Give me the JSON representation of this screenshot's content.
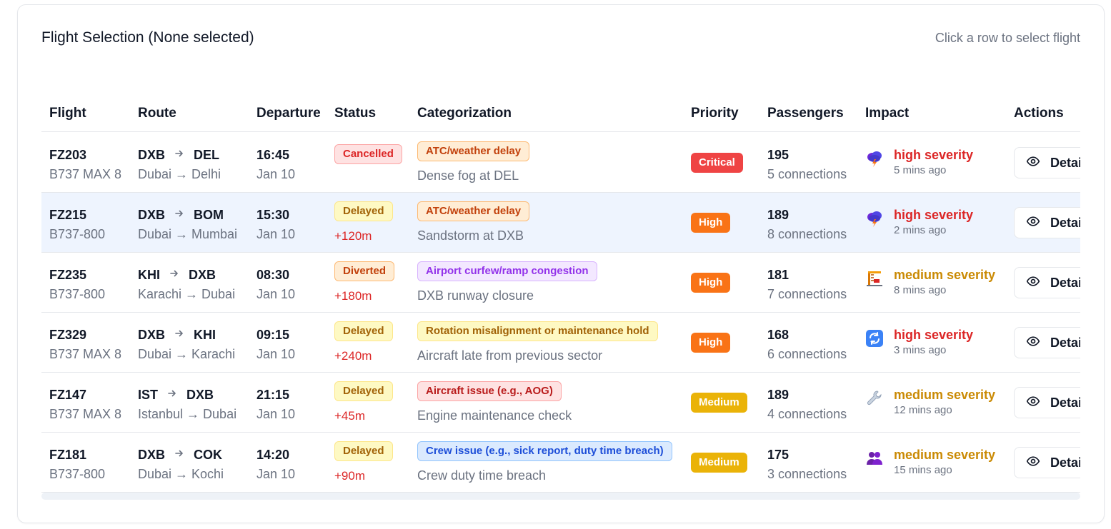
{
  "card": {
    "title": "Flight Selection (None selected)",
    "hint": "Click a row to select flight"
  },
  "columns": {
    "flight": "Flight",
    "route": "Route",
    "departure": "Departure",
    "status": "Status",
    "categorization": "Categorization",
    "priority": "Priority",
    "passengers": "Passengers",
    "impact": "Impact",
    "actions": "Actions"
  },
  "action_label": "Details",
  "route_arrow": "→",
  "rows": [
    {
      "flight": "FZ203",
      "aircraft": "B737 MAX 8",
      "from": "DXB",
      "to": "DEL",
      "route_desc": "Dubai → Delhi",
      "time": "16:45",
      "date": "Jan 10",
      "status": "Cancelled",
      "delay": "",
      "category": "ATC/weather delay",
      "category_desc": "Dense fog at DEL",
      "priority": "Critical",
      "passengers": "195",
      "connections": "5 connections",
      "severity": "high severity",
      "ago": "5 mins ago",
      "impact_icon": "storm-cloud-icon"
    },
    {
      "flight": "FZ215",
      "aircraft": "B737-800",
      "from": "DXB",
      "to": "BOM",
      "route_desc": "Dubai → Mumbai",
      "time": "15:30",
      "date": "Jan 10",
      "status": "Delayed",
      "delay": "+120m",
      "category": "ATC/weather delay",
      "category_desc": "Sandstorm at DXB",
      "priority": "High",
      "passengers": "189",
      "connections": "8 connections",
      "severity": "high severity",
      "ago": "2 mins ago",
      "impact_icon": "storm-cloud-icon"
    },
    {
      "flight": "FZ235",
      "aircraft": "B737-800",
      "from": "KHI",
      "to": "DXB",
      "route_desc": "Karachi → Dubai",
      "time": "08:30",
      "date": "Jan 10",
      "status": "Diverted",
      "delay": "+180m",
      "category": "Airport curfew/ramp congestion",
      "category_desc": "DXB runway closure",
      "priority": "High",
      "passengers": "181",
      "connections": "7 connections",
      "severity": "medium severity",
      "ago": "8 mins ago",
      "impact_icon": "crane-icon"
    },
    {
      "flight": "FZ329",
      "aircraft": "B737 MAX 8",
      "from": "DXB",
      "to": "KHI",
      "route_desc": "Dubai → Karachi",
      "time": "09:15",
      "date": "Jan 10",
      "status": "Delayed",
      "delay": "+240m",
      "category": "Rotation misalignment or maintenance hold",
      "category_desc": "Aircraft late from previous sector",
      "priority": "High",
      "passengers": "168",
      "connections": "6 connections",
      "severity": "high severity",
      "ago": "3 mins ago",
      "impact_icon": "rotate-arrows-icon"
    },
    {
      "flight": "FZ147",
      "aircraft": "B737 MAX 8",
      "from": "IST",
      "to": "DXB",
      "route_desc": "Istanbul → Dubai",
      "time": "21:15",
      "date": "Jan 10",
      "status": "Delayed",
      "delay": "+45m",
      "category": "Aircraft issue (e.g., AOG)",
      "category_desc": "Engine maintenance check",
      "priority": "Medium",
      "passengers": "189",
      "connections": "4 connections",
      "severity": "medium severity",
      "ago": "12 mins ago",
      "impact_icon": "wrench-icon"
    },
    {
      "flight": "FZ181",
      "aircraft": "B737-800",
      "from": "DXB",
      "to": "COK",
      "route_desc": "Dubai → Kochi",
      "time": "14:20",
      "date": "Jan 10",
      "status": "Delayed",
      "delay": "+90m",
      "category": "Crew issue (e.g., sick report, duty time breach)",
      "category_desc": "Crew duty time breach",
      "priority": "Medium",
      "passengers": "175",
      "connections": "3 connections",
      "severity": "medium severity",
      "ago": "15 mins ago",
      "impact_icon": "people-icon"
    }
  ],
  "colors": {
    "selected_row": "#eef4fe",
    "critical": "#ef4444",
    "high": "#f97316",
    "medium": "#eab308",
    "high_severity_text": "#dc2626",
    "medium_severity_text": "#ca8a04"
  }
}
